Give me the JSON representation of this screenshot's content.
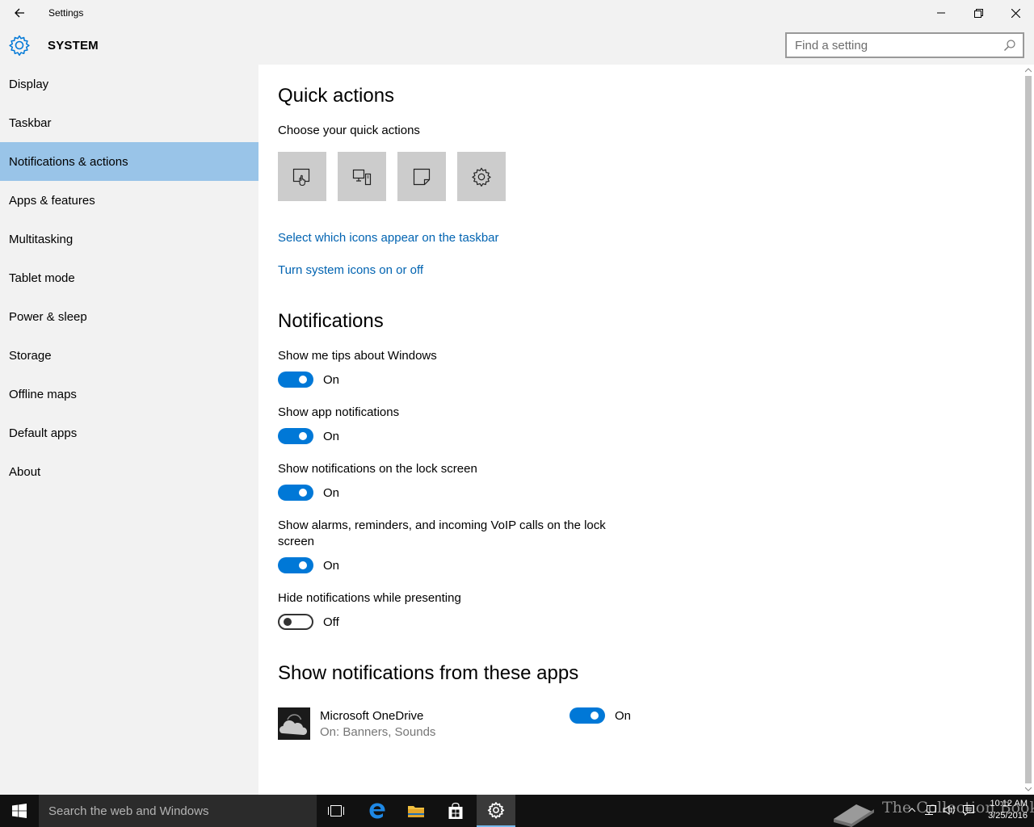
{
  "window": {
    "title": "Settings"
  },
  "header": {
    "section": "SYSTEM",
    "search_placeholder": "Find a setting"
  },
  "sidebar": {
    "items": [
      {
        "label": "Display"
      },
      {
        "label": "Taskbar"
      },
      {
        "label": "Notifications & actions",
        "selected": true
      },
      {
        "label": "Apps & features"
      },
      {
        "label": "Multitasking"
      },
      {
        "label": "Tablet mode"
      },
      {
        "label": "Power & sleep"
      },
      {
        "label": "Storage"
      },
      {
        "label": "Offline maps"
      },
      {
        "label": "Default apps"
      },
      {
        "label": "About"
      }
    ]
  },
  "quick_actions": {
    "heading": "Quick actions",
    "subheading": "Choose your quick actions",
    "tiles": [
      {
        "icon": "tablet-mode-icon"
      },
      {
        "icon": "connect-icon"
      },
      {
        "icon": "note-icon"
      },
      {
        "icon": "settings-icon"
      }
    ],
    "link_taskbar_icons": "Select which icons appear on the taskbar",
    "link_system_icons": "Turn system icons on or off"
  },
  "notifications": {
    "heading": "Notifications",
    "settings": [
      {
        "label": "Show me tips about Windows",
        "state": "On",
        "on": true
      },
      {
        "label": "Show app notifications",
        "state": "On",
        "on": true
      },
      {
        "label": "Show notifications on the lock screen",
        "state": "On",
        "on": true
      },
      {
        "label_line1": "Show alarms, reminders, and incoming VoIP calls on the lock",
        "label_line2": "screen",
        "state": "On",
        "on": true
      },
      {
        "label": "Hide notifications while presenting",
        "state": "Off",
        "on": false
      }
    ]
  },
  "apps_section": {
    "heading": "Show notifications from these apps",
    "apps": [
      {
        "name": "Microsoft OneDrive",
        "detail": "On: Banners, Sounds",
        "state": "On",
        "on": true,
        "icon": "onedrive-cloud-icon"
      }
    ]
  },
  "taskbar": {
    "search_placeholder": "Search the web and Windows",
    "watermark": "The Collection Book",
    "clock_time": "10:12 AM",
    "clock_date": "3/25/2016"
  },
  "colors": {
    "accent": "#0078d7",
    "link": "#0063b1",
    "selection": "#99c4e8",
    "taskbar": "#111111"
  }
}
